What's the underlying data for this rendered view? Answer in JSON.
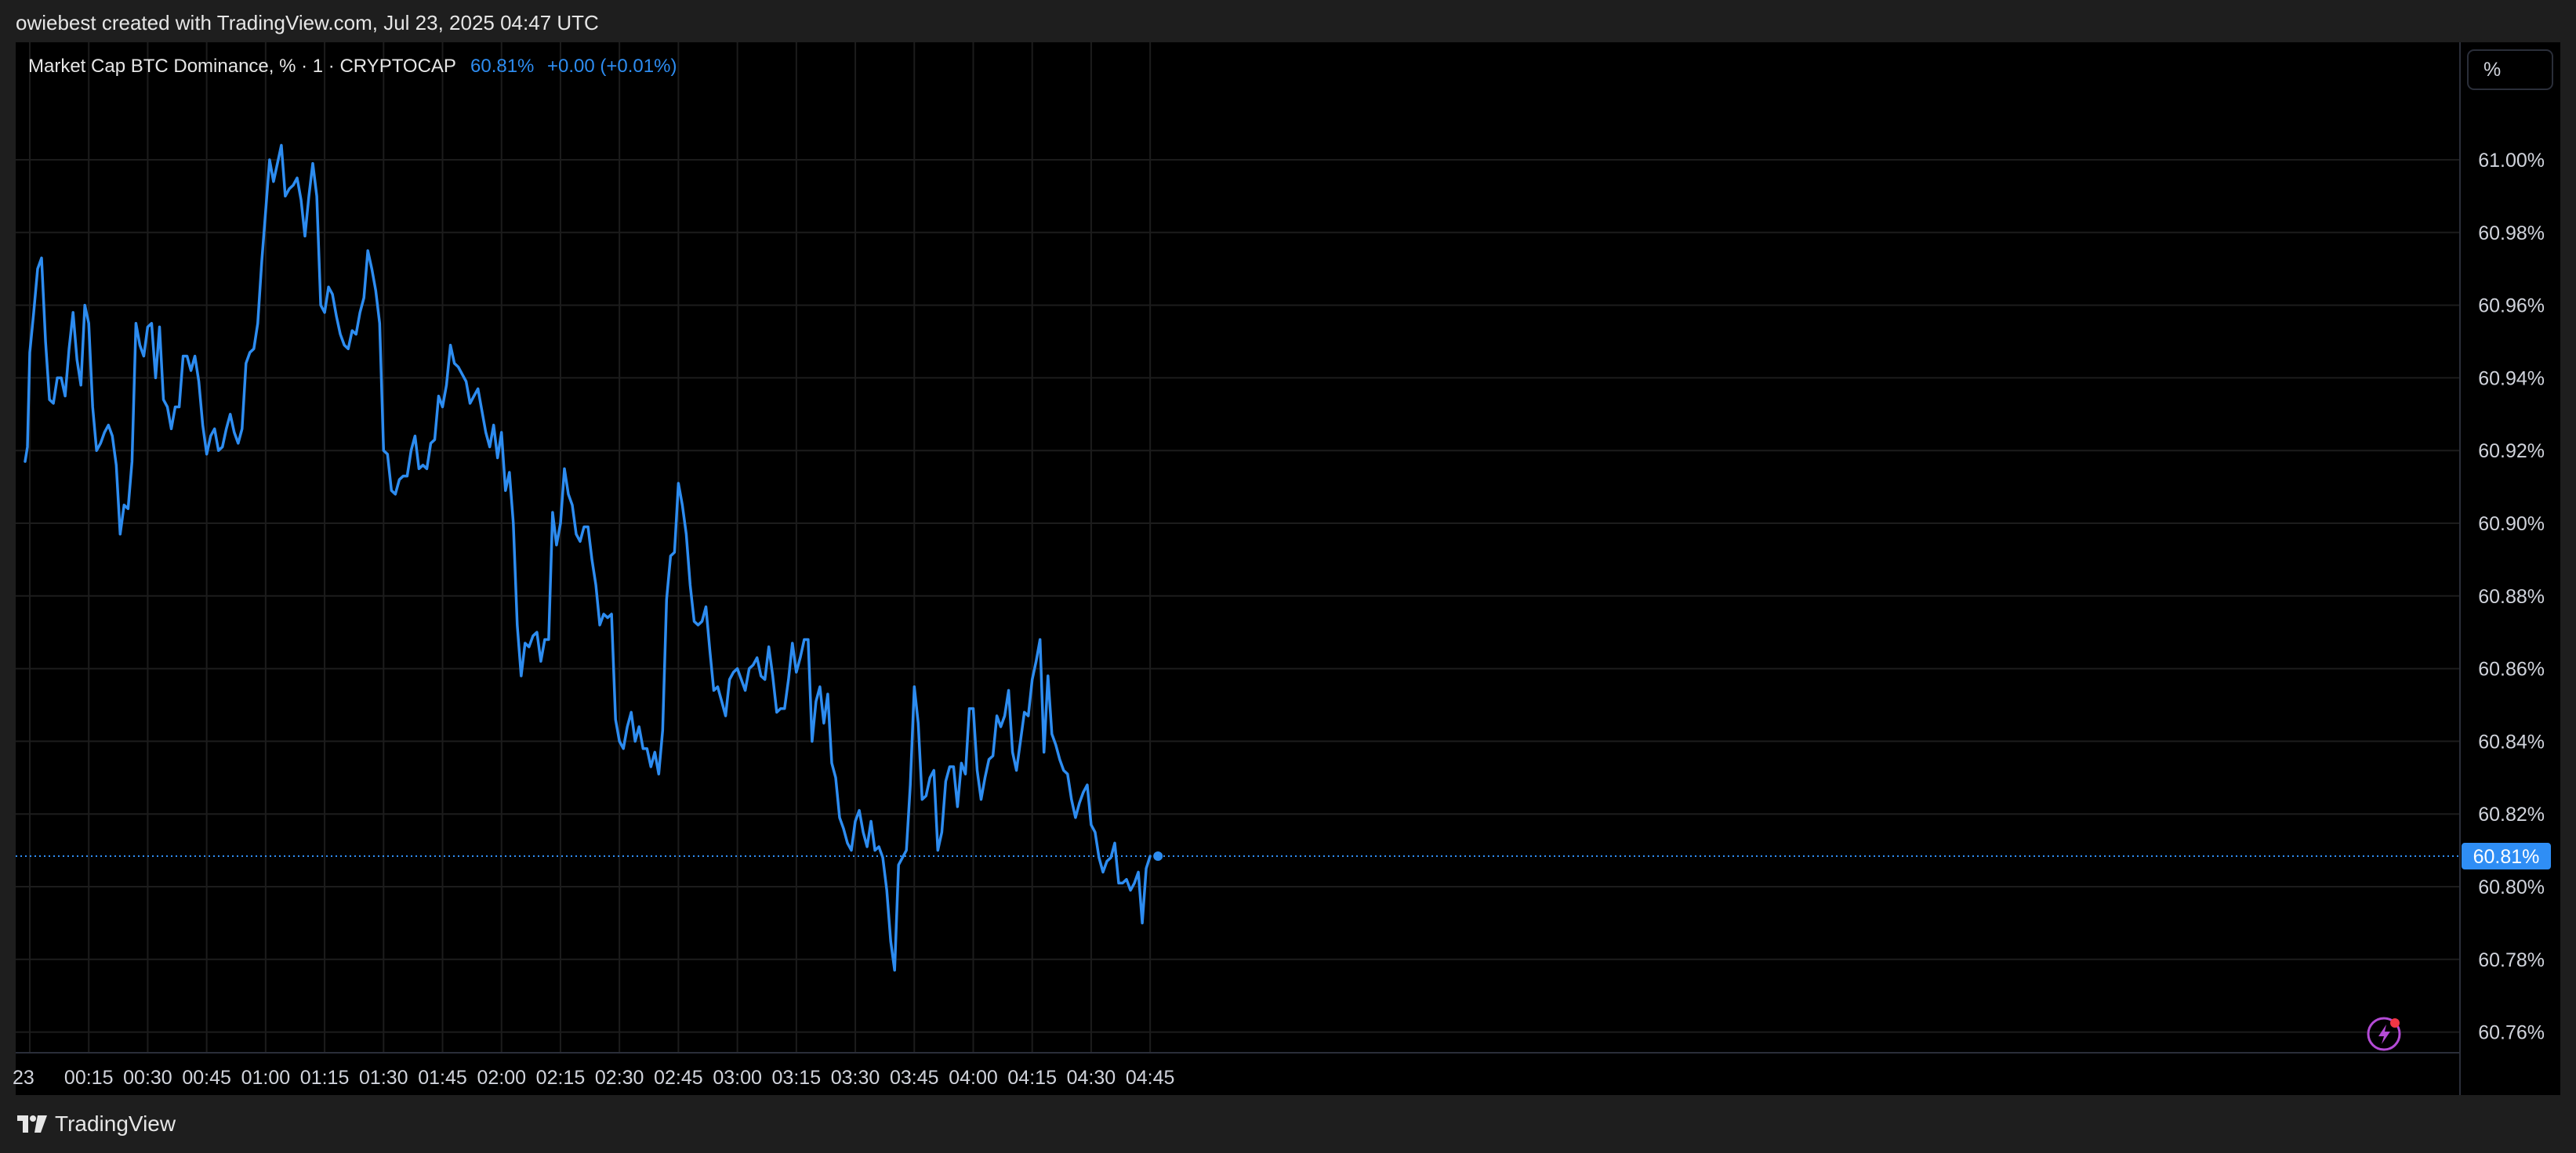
{
  "header": {
    "credit": "owiebest created with TradingView.com, Jul 23, 2025 04:47 UTC"
  },
  "legend": {
    "symbol": "Market Cap BTC Dominance, % · 1 · CRYPTOCAP",
    "last": "60.81%",
    "change": "+0.00 (+0.01%)"
  },
  "scale_button": "%",
  "footer": {
    "brand": "TradingView",
    "logo_icon": "tradingview-logo-icon"
  },
  "bolt_icon": "lightning-bolt-icon",
  "colors": {
    "line": "#2d8cf0",
    "price_tag": "#2f8ef5",
    "grid": "#1c1c1c",
    "background": "#000000",
    "bolt": "#b44bd6",
    "bolt_dot": "#f23645"
  },
  "chart_data": {
    "type": "line",
    "title": "Market Cap BTC Dominance, % · 1 · CRYPTOCAP",
    "y_unit": "%",
    "y_ticks": [
      "61.00%",
      "60.98%",
      "60.96%",
      "60.94%",
      "60.92%",
      "60.90%",
      "60.88%",
      "60.86%",
      "60.84%",
      "60.82%",
      "60.80%",
      "60.78%",
      "60.76%"
    ],
    "y_tick_values": [
      61.0,
      60.98,
      60.96,
      60.94,
      60.92,
      60.9,
      60.88,
      60.86,
      60.84,
      60.82,
      60.8,
      60.78,
      60.76
    ],
    "x_ticks": [
      "23",
      "00:15",
      "00:30",
      "00:45",
      "01:00",
      "01:15",
      "01:30",
      "01:45",
      "02:00",
      "02:15",
      "02:30",
      "02:45",
      "03:00",
      "03:15",
      "03:30",
      "03:45",
      "04:00",
      "04:15",
      "04:30",
      "04:45"
    ],
    "x_tick_minutes": [
      0,
      15,
      30,
      45,
      60,
      75,
      90,
      105,
      120,
      135,
      150,
      165,
      180,
      195,
      210,
      225,
      240,
      255,
      270,
      285
    ],
    "ylim": [
      60.752,
      61.024
    ],
    "last_value_label": "60.81%",
    "last_value": 60.8084,
    "grid": true,
    "series": [
      {
        "x_minutes": [
          -1.2,
          -0.6,
          0,
          1,
          2,
          3,
          4,
          5,
          6,
          7,
          8,
          9,
          10,
          11,
          12,
          13,
          14,
          15,
          16,
          17,
          18,
          19,
          20,
          21,
          22,
          23,
          24,
          25,
          26,
          27,
          28,
          29,
          30,
          31,
          32,
          33,
          34,
          35,
          36,
          37,
          38,
          39,
          40,
          41,
          42,
          43,
          44,
          45,
          46,
          47,
          48,
          49,
          50,
          51,
          52,
          53,
          54,
          55,
          56,
          57,
          58,
          59,
          60,
          61,
          62,
          63,
          64,
          65,
          66,
          67,
          68,
          69,
          70,
          71,
          72,
          73,
          74,
          75,
          76,
          77,
          78,
          79,
          80,
          81,
          82,
          83,
          84,
          85,
          86,
          87,
          88,
          89,
          90,
          91,
          92,
          93,
          94,
          95,
          96,
          97,
          98,
          99,
          100,
          101,
          102,
          103,
          104,
          105,
          106,
          107,
          108,
          109,
          110,
          111,
          112,
          113,
          114,
          115,
          116,
          117,
          118,
          119,
          120,
          121,
          122,
          123,
          124,
          125,
          126,
          127,
          128,
          129,
          130,
          131,
          132,
          133,
          134,
          135,
          136,
          137,
          138,
          139,
          140,
          141,
          142,
          143,
          144,
          145,
          146,
          147,
          148,
          149,
          150,
          151,
          152,
          153,
          154,
          155,
          156,
          157,
          158,
          159,
          160,
          161,
          162,
          163,
          164,
          165,
          166,
          167,
          168,
          169,
          170,
          171,
          172,
          173,
          174,
          175,
          176,
          177,
          178,
          179,
          180,
          181,
          182,
          183,
          184,
          185,
          186,
          187,
          188,
          189,
          190,
          191,
          192,
          193,
          194,
          195,
          196,
          197,
          198,
          199,
          200,
          201,
          202,
          203,
          204,
          205,
          206,
          207,
          208,
          209,
          210,
          211,
          212,
          213,
          214,
          215,
          216,
          217,
          218,
          219,
          220,
          221,
          222,
          223,
          224,
          225,
          226,
          227,
          228,
          229,
          230,
          231,
          232,
          233,
          234,
          235,
          236,
          237,
          238,
          239,
          240,
          241,
          242,
          243,
          244,
          245,
          246,
          247,
          248,
          249,
          250,
          251,
          252,
          253,
          254,
          255,
          256,
          257,
          258,
          259,
          260,
          261,
          262,
          263,
          264,
          265,
          266,
          267,
          268,
          269,
          270,
          271,
          272,
          273,
          274,
          275,
          276,
          277,
          278,
          279,
          280,
          281,
          282,
          283,
          284,
          285,
          286,
          287
        ],
        "values": [
          60.917,
          60.921,
          60.947,
          60.958,
          60.97,
          60.973,
          60.95,
          60.934,
          60.933,
          60.94,
          60.94,
          60.935,
          60.948,
          60.958,
          60.945,
          60.938,
          60.96,
          60.955,
          60.932,
          60.92,
          60.922,
          60.925,
          60.927,
          60.924,
          60.916,
          60.897,
          60.905,
          60.904,
          60.917,
          60.955,
          60.949,
          60.946,
          60.954,
          60.955,
          60.94,
          60.954,
          60.934,
          60.932,
          60.926,
          60.932,
          60.932,
          60.946,
          60.946,
          60.942,
          60.946,
          60.939,
          60.927,
          60.919,
          60.924,
          60.926,
          60.92,
          60.921,
          60.926,
          60.93,
          60.925,
          60.922,
          60.926,
          60.944,
          60.947,
          60.948,
          60.955,
          60.972,
          60.986,
          61.0,
          60.994,
          60.999,
          61.004,
          60.99,
          60.992,
          60.993,
          60.995,
          60.989,
          60.979,
          60.99,
          60.999,
          60.99,
          60.96,
          60.958,
          60.965,
          60.963,
          60.957,
          60.952,
          60.949,
          60.948,
          60.953,
          60.952,
          60.958,
          60.962,
          60.975,
          60.97,
          60.964,
          60.955,
          60.92,
          60.919,
          60.909,
          60.908,
          60.912,
          60.913,
          60.913,
          60.92,
          60.924,
          60.915,
          60.916,
          60.915,
          60.922,
          60.923,
          60.935,
          60.932,
          60.938,
          60.949,
          60.944,
          60.943,
          60.941,
          60.939,
          60.933,
          60.935,
          60.937,
          60.931,
          60.925,
          60.921,
          60.927,
          60.918,
          60.925,
          60.909,
          60.914,
          60.9,
          60.872,
          60.858,
          60.867,
          60.866,
          60.869,
          60.87,
          60.862,
          60.868,
          60.868,
          60.903,
          60.894,
          60.9,
          60.915,
          60.908,
          60.905,
          60.897,
          60.895,
          60.899,
          60.899,
          60.89,
          60.883,
          60.872,
          60.875,
          60.874,
          60.875,
          60.846,
          60.84,
          60.838,
          60.844,
          60.848,
          60.84,
          60.844,
          60.838,
          60.838,
          60.833,
          60.837,
          60.831,
          60.843,
          60.879,
          60.891,
          60.892,
          60.911,
          60.905,
          60.897,
          60.883,
          60.873,
          60.872,
          60.873,
          60.877,
          60.865,
          60.854,
          60.855,
          60.851,
          60.847,
          60.857,
          60.859,
          60.86,
          60.857,
          60.854,
          60.86,
          60.861,
          60.863,
          60.858,
          60.857,
          60.866,
          60.858,
          60.848,
          60.849,
          60.849,
          60.857,
          60.867,
          60.859,
          60.863,
          60.868,
          60.868,
          60.84,
          60.851,
          60.855,
          60.845,
          60.853,
          60.834,
          60.83,
          60.819,
          60.816,
          60.812,
          60.81,
          60.818,
          60.821,
          60.815,
          60.811,
          60.818,
          60.81,
          60.811,
          60.808,
          60.799,
          60.785,
          60.777,
          60.806,
          60.808,
          60.81,
          60.828,
          60.855,
          60.845,
          60.824,
          60.825,
          60.83,
          60.832,
          60.81,
          60.815,
          60.829,
          60.833,
          60.833,
          60.822,
          60.834,
          60.831,
          60.849,
          60.849,
          60.832,
          60.824,
          60.83,
          60.835,
          60.836,
          60.847,
          60.844,
          60.847,
          60.854,
          60.837,
          60.832,
          60.84,
          60.848,
          60.847,
          60.857,
          60.862,
          60.868,
          60.837,
          60.858,
          60.842,
          60.839,
          60.835,
          60.832,
          60.831,
          60.824,
          60.819,
          60.823,
          60.826,
          60.828,
          60.817,
          60.815,
          60.808,
          60.804,
          60.807,
          60.808,
          60.812,
          60.801,
          60.801,
          60.802,
          60.799,
          60.801,
          60.804,
          60.79,
          60.805,
          60.8084
        ]
      }
    ]
  }
}
